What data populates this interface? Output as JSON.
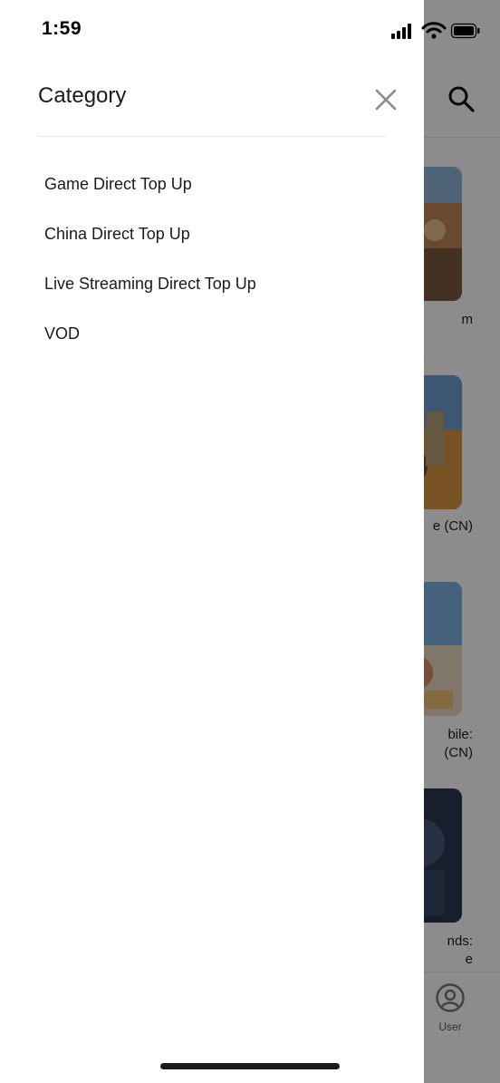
{
  "status_bar": {
    "time": "1:59",
    "icons": [
      "signal-icon",
      "wifi-icon",
      "battery-icon"
    ]
  },
  "drawer": {
    "title": "Category",
    "close_icon": "close-icon",
    "items": [
      {
        "label": "Game Direct Top Up"
      },
      {
        "label": "China Direct Top Up"
      },
      {
        "label": "Live Streaming Direct Top Up"
      },
      {
        "label": "VOD"
      }
    ]
  },
  "background": {
    "search_icon": "search-icon",
    "card_labels": [
      "m",
      "e (CN)",
      "bile:",
      "(CN)",
      "nds:",
      "e"
    ],
    "bottom_nav": {
      "user_label": "User",
      "user_icon": "user-icon"
    }
  },
  "colors": {
    "drawer_bg": "#ffffff",
    "overlay": "rgba(0,0,0,0.45)",
    "text": "#1a1a1a",
    "close_icon": "#8a8a8a"
  }
}
